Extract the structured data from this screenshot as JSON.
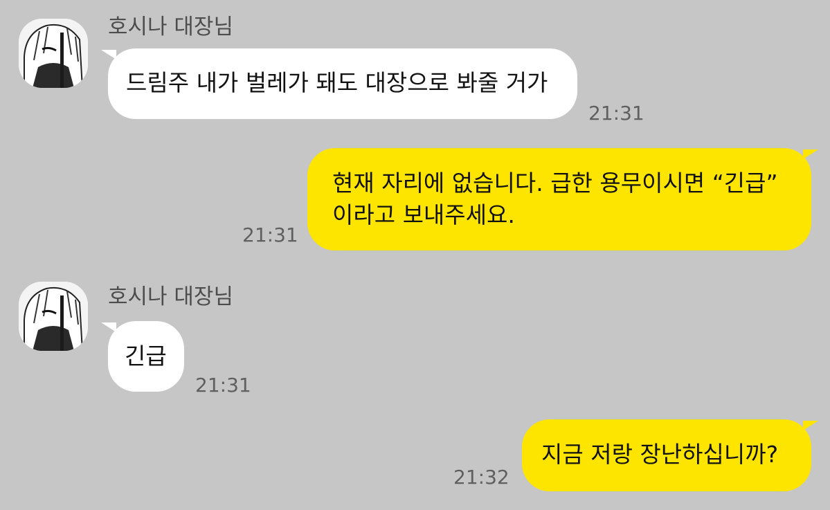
{
  "chat": {
    "messages": [
      {
        "direction": "incoming",
        "sender": "호시나 대장님",
        "avatar_icon": "profile-avatar-icon",
        "lines": [
          "드림주 내가 벌레가 돼도 대장으로 봐줄 거가"
        ],
        "time": "21:31"
      },
      {
        "direction": "outgoing",
        "lines": [
          "현재 자리에 없습니다. 급한 용무이시면 “긴급”",
          "이라고 보내주세요."
        ],
        "time": "21:31"
      },
      {
        "direction": "incoming",
        "sender": "호시나 대장님",
        "avatar_icon": "profile-avatar-icon",
        "lines": [
          "긴급"
        ],
        "time": "21:31"
      },
      {
        "direction": "outgoing",
        "lines": [
          "지금 저랑 장난하십니까?"
        ],
        "time": "21:32"
      }
    ]
  },
  "colors": {
    "background": "#c6c6c6",
    "incoming_bubble": "#ffffff",
    "outgoing_bubble": "#fee500",
    "sender_name": "#4d4d4d",
    "timestamp": "#5f5f5f"
  }
}
